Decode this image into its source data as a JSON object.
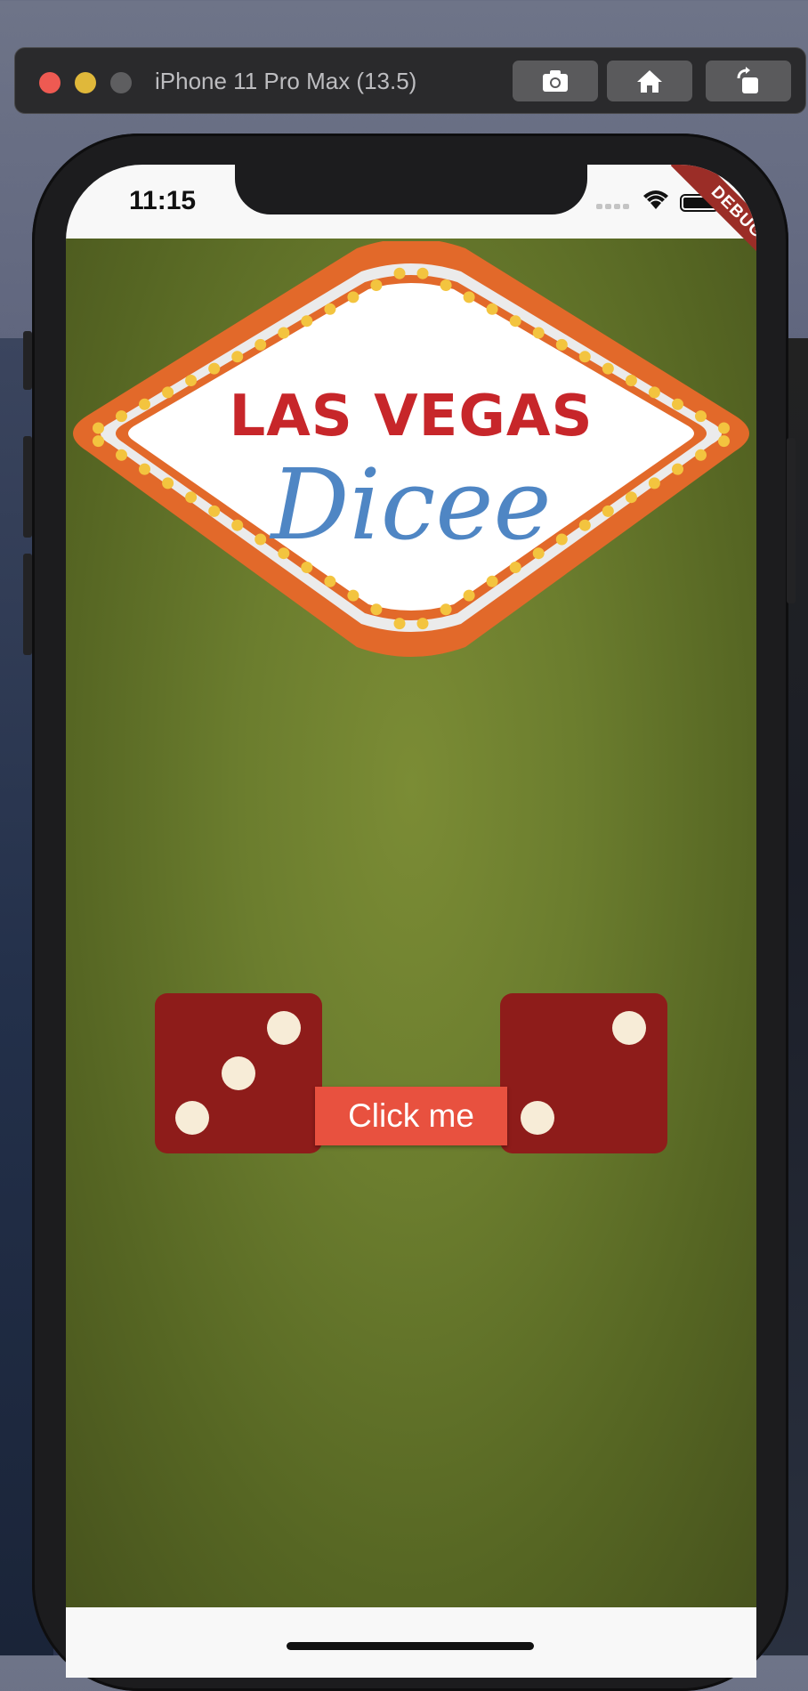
{
  "simulator": {
    "title": "iPhone 11 Pro Max (13.5)",
    "buttons": [
      {
        "name": "screenshot-button",
        "icon": "camera-icon"
      },
      {
        "name": "home-button",
        "icon": "home-icon"
      },
      {
        "name": "rotate-button",
        "icon": "rotate-icon"
      }
    ]
  },
  "status_bar": {
    "time": "11:15"
  },
  "debug_banner": "DEBUG",
  "logo": {
    "line1": "LAS VEGAS",
    "line2": "Dicee"
  },
  "dice": {
    "left_value": 3,
    "right_value": 2
  },
  "roll_button": {
    "label": "Click me"
  },
  "colors": {
    "felt": "#6b7d2e",
    "die": "#8e1c1a",
    "pip": "#f7ecd7",
    "button": "#e8513f",
    "title_red": "#c7262a",
    "script_blue": "#4f86c4",
    "marquee_orange": "#e2692a",
    "bulb_yellow": "#f3c43f"
  }
}
